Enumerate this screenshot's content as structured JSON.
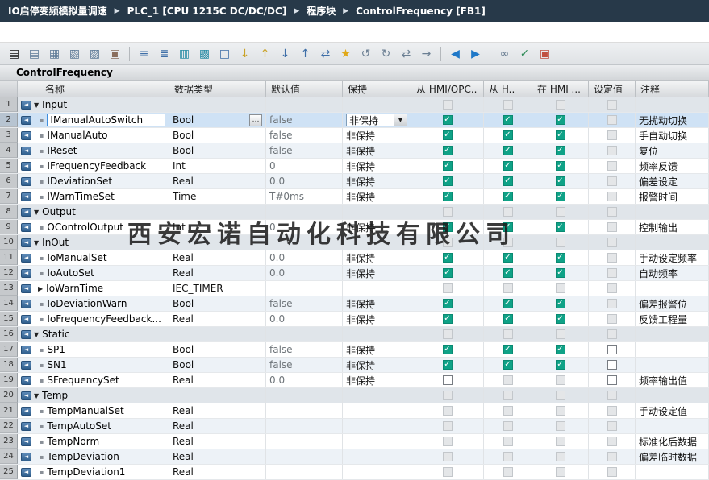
{
  "window": {
    "breadcrumb": [
      "IO启停变频模拟量调速",
      "PLC_1 [CPU 1215C DC/DC/DC]",
      "程序块",
      "ControlFrequency [FB1]"
    ],
    "breadcrumb_separator": "▶"
  },
  "toolbar": {
    "icons": [
      {
        "name": "insert-row-icon",
        "glyph": "▤",
        "color": "#5d7astro"
      },
      {
        "name": "insert-row-icon",
        "glyph": "▤",
        "color": "#5d7a97"
      },
      {
        "name": "add-row-icon",
        "glyph": "▦",
        "color": "#5d7a97"
      },
      {
        "name": "insert-row-after-icon",
        "glyph": "▧",
        "color": "#5d7a97"
      },
      {
        "name": "delete-row-icon",
        "glyph": "▨",
        "color": "#5d7a97"
      },
      {
        "name": "keep-actual-values-icon",
        "glyph": "▣",
        "color": "#8a6d5c"
      },
      {
        "name": "separator"
      },
      {
        "name": "expand-members-icon",
        "glyph": "≡",
        "color": "#3f6fa8"
      },
      {
        "name": "collapse-members-icon",
        "glyph": "≣",
        "color": "#3f6fa8"
      },
      {
        "name": "absolute-view-icon",
        "glyph": "▥",
        "color": "#2e8fa8"
      },
      {
        "name": "symbolic-view-icon",
        "glyph": "▩",
        "color": "#2e8fa8"
      },
      {
        "name": "comment-icon",
        "glyph": "□",
        "color": "#3f6fa8"
      },
      {
        "name": "import-source-icon",
        "glyph": "↓",
        "color": "#c9a227"
      },
      {
        "name": "export-source-icon",
        "glyph": "↑",
        "color": "#c9a227"
      },
      {
        "name": "download-to-device-icon",
        "glyph": "↓",
        "color": "#3f6fa8"
      },
      {
        "name": "upload-from-device-icon",
        "glyph": "↑",
        "color": "#3f6fa8"
      },
      {
        "name": "compare-icon",
        "glyph": "⇄",
        "color": "#3f6fa8"
      },
      {
        "name": "favorites-icon",
        "glyph": "★",
        "color": "#e0a818"
      },
      {
        "name": "snapshot-icon",
        "glyph": "↺",
        "color": "#6b7f93"
      },
      {
        "name": "apply-snapshot-icon",
        "glyph": "↻",
        "color": "#6b7f93"
      },
      {
        "name": "copy-snapshot-to-start-values-icon",
        "glyph": "⇄",
        "color": "#6b7f93"
      },
      {
        "name": "load-start-values-icon",
        "glyph": "→",
        "color": "#6b7f93"
      },
      {
        "name": "separator"
      },
      {
        "name": "go-back-icon",
        "glyph": "◀",
        "color": "#1f78c8"
      },
      {
        "name": "go-forward-icon",
        "glyph": "▶",
        "color": "#1f78c8"
      },
      {
        "name": "separator"
      },
      {
        "name": "monitor-icon",
        "glyph": "∞",
        "color": "#6b7f93"
      },
      {
        "name": "consistency-check-icon",
        "glyph": "✓",
        "color": "#2e8b57"
      },
      {
        "name": "messages-icon",
        "glyph": "▣",
        "color": "#c05040"
      }
    ]
  },
  "block": {
    "title": "ControlFrequency"
  },
  "watermark": "西安宏诺自动化科技有限公司",
  "colors": {
    "check_teal": "#0fa287",
    "selection_blue": "#cfe2f5",
    "breadcrumb_bg": "#273949"
  },
  "table": {
    "selected_row_controls": {
      "type_browse_glyph": "…",
      "dropdown_arrow": "▼"
    },
    "columns": [
      {
        "key": "name",
        "label": "名称"
      },
      {
        "key": "type",
        "label": "数据类型"
      },
      {
        "key": "default",
        "label": "默认值"
      },
      {
        "key": "retain",
        "label": "保持"
      },
      {
        "key": "hmi_opc",
        "label": "从 HMI/OPC.."
      },
      {
        "key": "from_hmi",
        "label": "从 H.."
      },
      {
        "key": "in_hmi",
        "label": "在 HMI ..."
      },
      {
        "key": "setpoint",
        "label": "设定值"
      },
      {
        "key": "comment",
        "label": "注释"
      }
    ],
    "rows": [
      {
        "num": 1,
        "kind": "section",
        "name": "Input",
        "cb": [
          "disabled",
          "disabled",
          "disabled",
          "disabled"
        ],
        "comment": ""
      },
      {
        "num": 2,
        "kind": "var",
        "selected": true,
        "name": "IManualAutoSwitch",
        "type": "Bool",
        "type_browse": true,
        "default": "false",
        "retain": "非保持",
        "retain_dropdown": true,
        "cb": [
          "checked",
          "checked",
          "checked",
          "disabled"
        ],
        "comment": "无扰动切换"
      },
      {
        "num": 3,
        "kind": "var",
        "name": "IManualAuto",
        "type": "Bool",
        "default": "false",
        "retain": "非保持",
        "cb": [
          "checked",
          "checked",
          "checked",
          "disabled"
        ],
        "comment": "手自动切换"
      },
      {
        "num": 4,
        "kind": "var",
        "name": "IReset",
        "type": "Bool",
        "default": "false",
        "retain": "非保持",
        "cb": [
          "checked",
          "checked",
          "checked",
          "disabled"
        ],
        "comment": "复位"
      },
      {
        "num": 5,
        "kind": "var",
        "name": "IFrequencyFeedback",
        "type": "Int",
        "default": "0",
        "retain": "非保持",
        "cb": [
          "checked",
          "checked",
          "checked",
          "disabled"
        ],
        "comment": "频率反馈"
      },
      {
        "num": 6,
        "kind": "var",
        "name": "IDeviationSet",
        "type": "Real",
        "default": "0.0",
        "retain": "非保持",
        "cb": [
          "checked",
          "checked",
          "checked",
          "disabled"
        ],
        "comment": "偏差设定"
      },
      {
        "num": 7,
        "kind": "var",
        "name": "IWarnTimeSet",
        "type": "Time",
        "default": "T#0ms",
        "retain": "非保持",
        "cb": [
          "checked",
          "checked",
          "checked",
          "disabled"
        ],
        "comment": "报警时间"
      },
      {
        "num": 8,
        "kind": "section",
        "name": "Output",
        "cb": [
          "disabled",
          "disabled",
          "disabled",
          "disabled"
        ],
        "comment": ""
      },
      {
        "num": 9,
        "kind": "var",
        "name": "OControlOutput",
        "type": "Int",
        "default": "0",
        "retain": "非保持",
        "cb": [
          "checked",
          "checked",
          "checked",
          "disabled"
        ],
        "comment": "控制输出"
      },
      {
        "num": 10,
        "kind": "section",
        "name": "InOut",
        "cb": [
          "disabled",
          "disabled",
          "disabled",
          "disabled"
        ],
        "comment": ""
      },
      {
        "num": 11,
        "kind": "var",
        "name": "IoManualSet",
        "type": "Real",
        "default": "0.0",
        "retain": "非保持",
        "cb": [
          "checked",
          "checked",
          "checked",
          "disabled"
        ],
        "comment": "手动设定频率"
      },
      {
        "num": 12,
        "kind": "var",
        "name": "IoAutoSet",
        "type": "Real",
        "default": "0.0",
        "retain": "非保持",
        "cb": [
          "checked",
          "checked",
          "checked",
          "disabled"
        ],
        "comment": "自动频率"
      },
      {
        "num": 13,
        "kind": "var",
        "expander": "right",
        "name": "IoWarnTime",
        "type": "IEC_TIMER",
        "default": "",
        "retain": "",
        "cb": [
          "disabled",
          "disabled",
          "disabled",
          "disabled"
        ],
        "comment": ""
      },
      {
        "num": 14,
        "kind": "var",
        "name": "IoDeviationWarn",
        "type": "Bool",
        "default": "false",
        "retain": "非保持",
        "cb": [
          "checked",
          "checked",
          "checked",
          "disabled"
        ],
        "comment": "偏差报警位"
      },
      {
        "num": 15,
        "kind": "var",
        "name": "IoFrequencyFeedback...",
        "type": "Real",
        "default": "0.0",
        "retain": "非保持",
        "cb": [
          "checked",
          "checked",
          "checked",
          "disabled"
        ],
        "comment": "反馈工程量"
      },
      {
        "num": 16,
        "kind": "section",
        "name": "Static",
        "cb": [
          "disabled",
          "disabled",
          "disabled",
          "disabled"
        ],
        "comment": ""
      },
      {
        "num": 17,
        "kind": "var",
        "name": "SP1",
        "type": "Bool",
        "default": "false",
        "retain": "非保持",
        "cb": [
          "checked",
          "checked",
          "checked",
          "unchecked"
        ],
        "comment": ""
      },
      {
        "num": 18,
        "kind": "var",
        "name": "SN1",
        "type": "Bool",
        "default": "false",
        "retain": "非保持",
        "cb": [
          "checked",
          "checked",
          "checked",
          "unchecked"
        ],
        "comment": ""
      },
      {
        "num": 19,
        "kind": "var",
        "name": "SFrequencySet",
        "type": "Real",
        "default": "0.0",
        "retain": "非保持",
        "cb": [
          "unchecked",
          "disabled",
          "disabled",
          "unchecked"
        ],
        "comment": "频率输出值"
      },
      {
        "num": 20,
        "kind": "section",
        "name": "Temp",
        "cb": [
          "disabled",
          "disabled",
          "disabled",
          "disabled"
        ],
        "comment": ""
      },
      {
        "num": 21,
        "kind": "var",
        "name": "TempManualSet",
        "type": "Real",
        "default": "",
        "retain": "",
        "cb": [
          "disabled",
          "disabled",
          "disabled",
          "disabled"
        ],
        "comment": "手动设定值"
      },
      {
        "num": 22,
        "kind": "var",
        "name": "TempAutoSet",
        "type": "Real",
        "default": "",
        "retain": "",
        "cb": [
          "disabled",
          "disabled",
          "disabled",
          "disabled"
        ],
        "comment": ""
      },
      {
        "num": 23,
        "kind": "var",
        "name": "TempNorm",
        "type": "Real",
        "default": "",
        "retain": "",
        "cb": [
          "disabled",
          "disabled",
          "disabled",
          "disabled"
        ],
        "comment": "标准化后数据"
      },
      {
        "num": 24,
        "kind": "var",
        "name": "TempDeviation",
        "type": "Real",
        "default": "",
        "retain": "",
        "cb": [
          "disabled",
          "disabled",
          "disabled",
          "disabled"
        ],
        "comment": "偏差临时数据"
      },
      {
        "num": 25,
        "kind": "var",
        "name": "TempDeviation1",
        "type": "Real",
        "default": "",
        "retain": "",
        "cb": [
          "disabled",
          "disabled",
          "disabled",
          "disabled"
        ],
        "comment": ""
      }
    ]
  }
}
